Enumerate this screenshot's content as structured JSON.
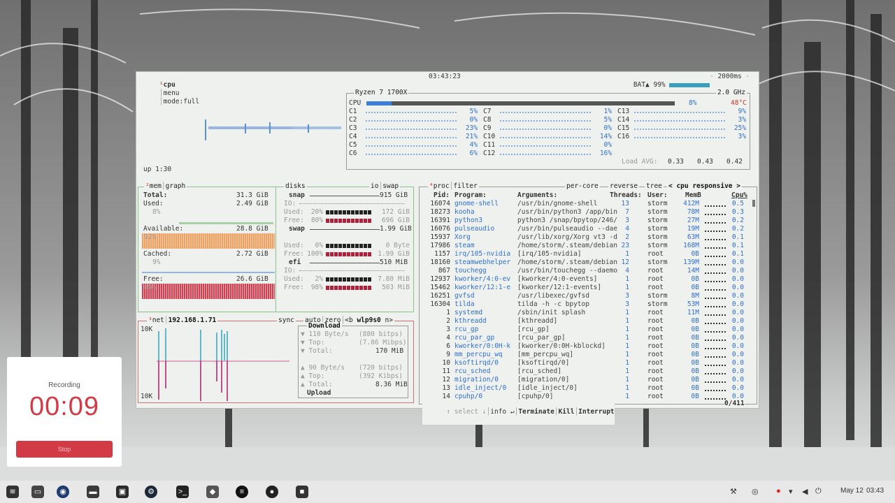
{
  "window": {
    "cpu_tab": "cpu",
    "menu_tab": "menu",
    "mode": "mode:full",
    "clock": "03:43:23",
    "battery": "BAT▲ 99%",
    "refresh": "2000ms",
    "uptime": "up 1:30"
  },
  "cpu": {
    "model": "Ryzen 7 1700X",
    "freq": "2.0 GHz",
    "total_label": "CPU",
    "total_pct": "8%",
    "temp": "48°C",
    "cores": [
      {
        "name": "C1",
        "pct": "5%"
      },
      {
        "name": "C2",
        "pct": "0%"
      },
      {
        "name": "C3",
        "pct": "23%"
      },
      {
        "name": "C4",
        "pct": "21%"
      },
      {
        "name": "C5",
        "pct": "4%"
      },
      {
        "name": "C6",
        "pct": "6%"
      },
      {
        "name": "C7",
        "pct": "1%"
      },
      {
        "name": "C8",
        "pct": "5%"
      },
      {
        "name": "C9",
        "pct": "0%"
      },
      {
        "name": "C10",
        "pct": "14%"
      },
      {
        "name": "C11",
        "pct": "0%"
      },
      {
        "name": "C12",
        "pct": "16%"
      },
      {
        "name": "C13",
        "pct": "9%"
      },
      {
        "name": "C14",
        "pct": "3%"
      },
      {
        "name": "C15",
        "pct": "25%"
      },
      {
        "name": "C16",
        "pct": "3%"
      }
    ],
    "load_label": "Load AVG:",
    "load": [
      "0.33",
      "0.43",
      "0.42"
    ]
  },
  "mem": {
    "title": "mem",
    "graph_tab": "graph",
    "total_label": "Total:",
    "total": "31.3 GiB",
    "used_label": "Used:",
    "used": "2.49 GiB",
    "used_pct": "8%",
    "avail_label": "Available:",
    "avail": "28.8 GiB",
    "avail_pct": "92%",
    "cached_label": "Cached:",
    "cached": "2.72 GiB",
    "cached_pct": "9%",
    "free_label": "Free:",
    "free": "26.6 GiB",
    "free_pct": "85%"
  },
  "disks": {
    "title": "disks",
    "io_tab": "io",
    "swap_tab": "swap",
    "items": [
      {
        "name": "snap",
        "size": "915 GiB",
        "io": "IO:",
        "used_label": "Used:",
        "used_pct": "20%",
        "used": "172 GiB",
        "free_label": "Free:",
        "free_pct": "80%",
        "free": "696 GiB"
      },
      {
        "name": "swap",
        "size": "1.99 GiB",
        "io": "",
        "used_label": "Used:",
        "used_pct": "0%",
        "used": "0 Byte",
        "free_label": "Free:",
        "free_pct": "100%",
        "free": "1.99 GiB"
      },
      {
        "name": "efi",
        "size": "510 MiB",
        "io": "IO:",
        "used_label": "Used:",
        "used_pct": "2%",
        "used": "7.80 MiB",
        "free_label": "Free:",
        "free_pct": "98%",
        "free": "503 MiB"
      }
    ]
  },
  "net": {
    "title": "net",
    "ip": "192.168.1.71",
    "sync": "sync",
    "auto": "auto",
    "zero": "zero",
    "prev": "<b",
    "iface": "wlp9s0",
    "next": "n>",
    "scale_top": "10K",
    "scale_bot": "10K",
    "download_label": "Download",
    "upload_label": "Upload",
    "down": {
      "rate": "110 Byte/s",
      "rate_bits": "(880 bitps)",
      "top_label": "Top:",
      "top": "(7.86 Mibps)",
      "total_label": "Total:",
      "total": "170 MiB"
    },
    "up": {
      "rate": "90 Byte/s",
      "rate_bits": "(720 bitps)",
      "top_label": "Top:",
      "top": "(392 Kibps)",
      "total_label": "Total:",
      "total": "8.36 MiB"
    }
  },
  "proc": {
    "title": "proc",
    "filter": "filter",
    "per_core": "per-core",
    "reverse": "reverse",
    "tree": "tree",
    "sort": "< cpu responsive >",
    "headers": {
      "pid": "Pid:",
      "program": "Program:",
      "args": "Arguments:",
      "threads": "Threads:",
      "user": "User:",
      "mem": "MemB",
      "cpu": "Cpu%"
    },
    "rows": [
      [
        "16074",
        "gnome-shell",
        "/usr/bin/gnome-shell",
        "13",
        "storm",
        "412M",
        "0.5"
      ],
      [
        "18273",
        "kooha",
        "/usr/bin/python3 /app/bin",
        "7",
        "storm",
        "78M",
        "0.3"
      ],
      [
        "16391",
        "python3",
        "python3 /snap/bpytop/246/",
        "3",
        "storm",
        "27M",
        "0.2"
      ],
      [
        "16076",
        "pulseaudio",
        "/usr/bin/pulseaudio --dae",
        "4",
        "storm",
        "19M",
        "0.2"
      ],
      [
        "15937",
        "Xorg",
        "/usr/lib/xorg/Xorg vt3 -d",
        "2",
        "storm",
        "63M",
        "0.1"
      ],
      [
        "17986",
        "steam",
        "/home/storm/.steam/debian",
        "23",
        "storm",
        "168M",
        "0.1"
      ],
      [
        "1157",
        "irq/105-nvidia",
        "[irq/105-nvidia]",
        "1",
        "root",
        "0B",
        "0.1"
      ],
      [
        "18160",
        "steamwebhelper",
        "/home/storm/.steam/debian",
        "12",
        "storm",
        "139M",
        "0.0"
      ],
      [
        "867",
        "touchegg",
        "/usr/bin/touchegg --daemo",
        "4",
        "root",
        "14M",
        "0.0"
      ],
      [
        "12937",
        "kworker/4:0-ev",
        "[kworker/4:0-events]",
        "1",
        "root",
        "0B",
        "0.0"
      ],
      [
        "15462",
        "kworker/12:1-e",
        "[kworker/12:1-events]",
        "1",
        "root",
        "0B",
        "0.0"
      ],
      [
        "16251",
        "gvfsd",
        "/usr/libexec/gvfsd",
        "3",
        "storm",
        "8M",
        "0.0"
      ],
      [
        "16304",
        "tilda",
        "tilda -h -c bpytop",
        "3",
        "storm",
        "53M",
        "0.0"
      ],
      [
        "1",
        "systemd",
        "/sbin/init splash",
        "1",
        "root",
        "11M",
        "0.0"
      ],
      [
        "2",
        "kthreadd",
        "[kthreadd]",
        "1",
        "root",
        "0B",
        "0.0"
      ],
      [
        "3",
        "rcu_gp",
        "[rcu_gp]",
        "1",
        "root",
        "0B",
        "0.0"
      ],
      [
        "4",
        "rcu_par_gp",
        "[rcu_par_gp]",
        "1",
        "root",
        "0B",
        "0.0"
      ],
      [
        "6",
        "kworker/0:0H-k",
        "[kworker/0:0H-kblockd]",
        "1",
        "root",
        "0B",
        "0.0"
      ],
      [
        "9",
        "mm_percpu_wq",
        "[mm_percpu_wq]",
        "1",
        "root",
        "0B",
        "0.0"
      ],
      [
        "10",
        "ksoftirqd/0",
        "[ksoftirqd/0]",
        "1",
        "root",
        "0B",
        "0.0"
      ],
      [
        "11",
        "rcu_sched",
        "[rcu_sched]",
        "1",
        "root",
        "0B",
        "0.0"
      ],
      [
        "12",
        "migration/0",
        "[migration/0]",
        "1",
        "root",
        "0B",
        "0.0"
      ],
      [
        "13",
        "idle_inject/0",
        "[idle_inject/0]",
        "1",
        "root",
        "0B",
        "0.0"
      ],
      [
        "14",
        "cpuhp/0",
        "[cpuhp/0]",
        "1",
        "root",
        "0B",
        "0.0"
      ]
    ],
    "select": "↑ select ↓",
    "info": "info ↵",
    "terminate": "Terminate",
    "kill": "Kill",
    "interrupt": "Interrupt",
    "count": "0/411"
  },
  "recording": {
    "label": "Recording",
    "time": "00:09",
    "stop": "Stop"
  },
  "taskbar": {
    "date": "May 12",
    "time": "03:43"
  },
  "colors": {
    "accent_red": "#d23a45",
    "mem_used": "#8bbf8b",
    "avail": "#f0a060",
    "free": "#d04050",
    "net_down": "#6cc",
    "net_up": "#c06"
  }
}
